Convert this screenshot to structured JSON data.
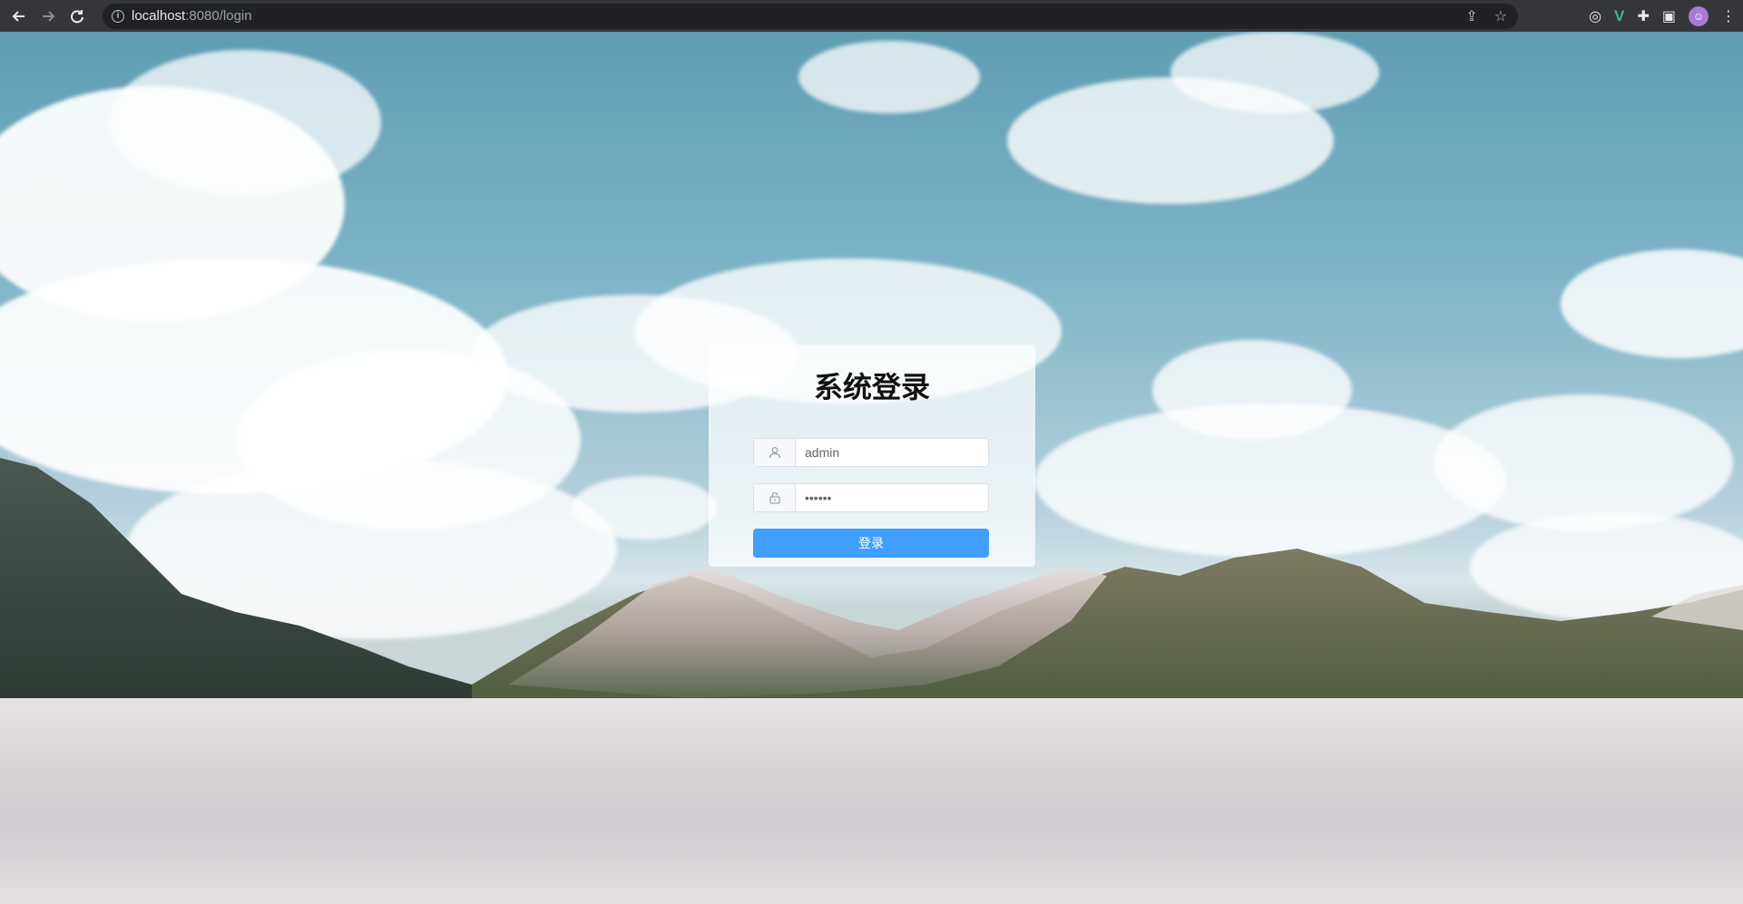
{
  "browser": {
    "url_host": "localhost",
    "url_path": ":8080/login",
    "back_icon": "arrow-left-icon",
    "forward_icon": "arrow-right-icon",
    "reload_icon": "reload-icon"
  },
  "login": {
    "title": "系统登录",
    "username_value": "admin",
    "password_value": "••••••",
    "submit_label": "登录",
    "accent_color": "#409eff"
  }
}
